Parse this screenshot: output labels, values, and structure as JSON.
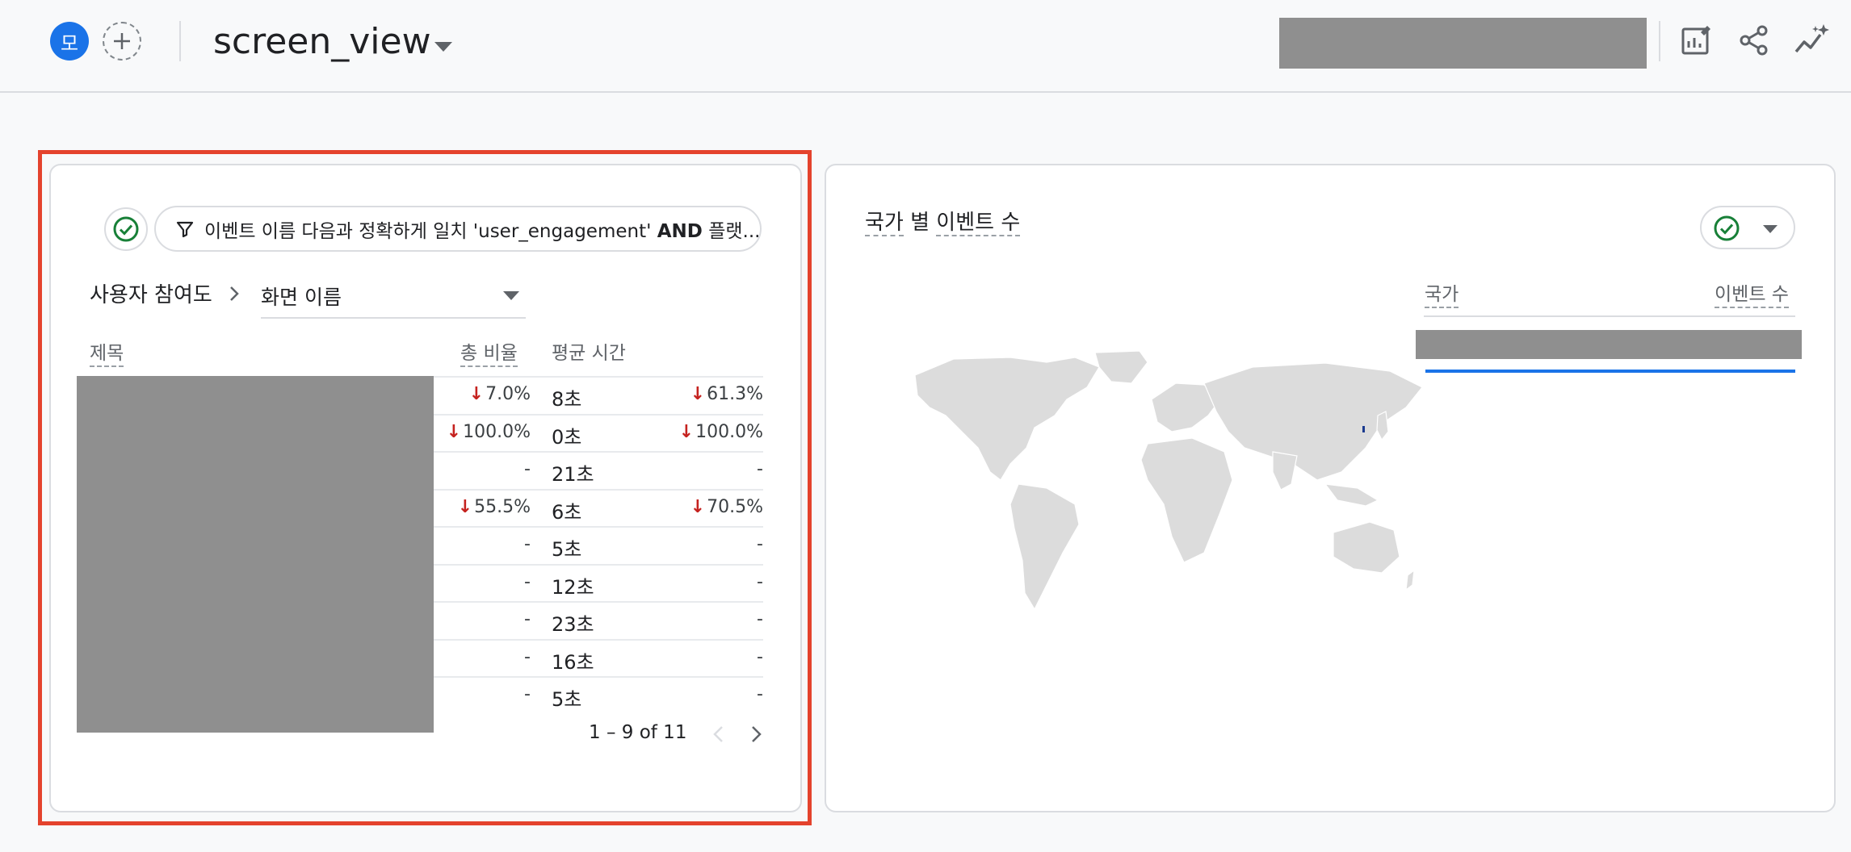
{
  "header": {
    "avatar_letter": "모",
    "add_symbol": "+",
    "title": "screen_view"
  },
  "filter": {
    "text_prefix": "이벤트 이름 다음과 정확하게 일치 'user_engagement' ",
    "text_bold": "AND",
    "text_suffix": " 플랫..."
  },
  "table": {
    "dimension_label": "사용자 참여도",
    "dimension_select": "화면 이름",
    "col_title": "제목",
    "col_ratio": "총 비율",
    "col_avg_time": "평균 시간",
    "rows": [
      {
        "ratio": "7.0%",
        "ratio_down": true,
        "avg": "8초",
        "change": "61.3%",
        "change_down": true
      },
      {
        "ratio": "100.0%",
        "ratio_down": true,
        "avg": "0초",
        "change": "100.0%",
        "change_down": true
      },
      {
        "ratio": "-",
        "ratio_down": false,
        "avg": "21초",
        "change": "-",
        "change_down": false
      },
      {
        "ratio": "55.5%",
        "ratio_down": true,
        "avg": "6초",
        "change": "70.5%",
        "change_down": true
      },
      {
        "ratio": "-",
        "ratio_down": false,
        "avg": "5초",
        "change": "-",
        "change_down": false
      },
      {
        "ratio": "-",
        "ratio_down": false,
        "avg": "12초",
        "change": "-",
        "change_down": false
      },
      {
        "ratio": "-",
        "ratio_down": false,
        "avg": "23초",
        "change": "-",
        "change_down": false
      },
      {
        "ratio": "-",
        "ratio_down": false,
        "avg": "16초",
        "change": "-",
        "change_down": false
      },
      {
        "ratio": "-",
        "ratio_down": false,
        "avg": "5초",
        "change": "-",
        "change_down": false
      }
    ],
    "pagination": "1 – 9 of 11"
  },
  "map_card": {
    "title_part1": "국가",
    "title_part2": "별",
    "title_part3": "이벤트 수",
    "col_country": "국가",
    "col_events": "이벤트 수"
  },
  "colors": {
    "accent": "#1a73e8",
    "decrease": "#c5221f",
    "success": "#188038",
    "highlight": "#e4432d"
  },
  "icons": [
    "plus-icon",
    "chevron-down-icon",
    "edit-report-icon",
    "share-icon",
    "insights-icon",
    "check-circle-icon",
    "filter-icon",
    "chevron-right-icon",
    "arrow-down-icon",
    "chevron-left-icon",
    "world-map"
  ]
}
